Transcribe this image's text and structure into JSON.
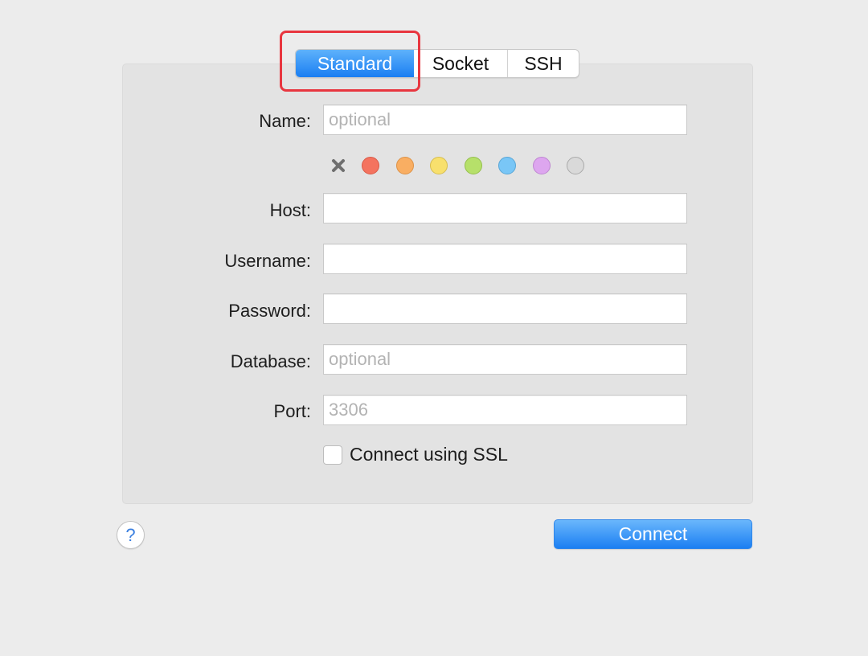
{
  "tabs": {
    "standard": "Standard",
    "socket": "Socket",
    "ssh": "SSH",
    "selected": "Standard"
  },
  "form": {
    "name_label": "Name:",
    "name_placeholder": "optional",
    "host_label": "Host:",
    "username_label": "Username:",
    "password_label": "Password:",
    "database_label": "Database:",
    "database_placeholder": "optional",
    "port_label": "Port:",
    "port_placeholder": "3306",
    "ssl_label": "Connect using SSL",
    "ssl_checked": false
  },
  "colors": [
    {
      "fill": "#f4735f",
      "border": "#d95a47"
    },
    {
      "fill": "#f9ae62",
      "border": "#dd9247"
    },
    {
      "fill": "#f8e06d",
      "border": "#d6bd4f"
    },
    {
      "fill": "#b6e06a",
      "border": "#95bf4e"
    },
    {
      "fill": "#79c6f6",
      "border": "#58a6d6"
    },
    {
      "fill": "#dda6ef",
      "border": "#bf86d2"
    },
    {
      "fill": "#d9d9d9",
      "border": "#a9a9a9"
    }
  ],
  "colors_clear_icon": "close-icon",
  "help_icon": "question-mark-icon",
  "help_glyph": "?",
  "connect_label": "Connect",
  "accent_color": "#1a7ef2",
  "highlight_color": "#e8363f"
}
